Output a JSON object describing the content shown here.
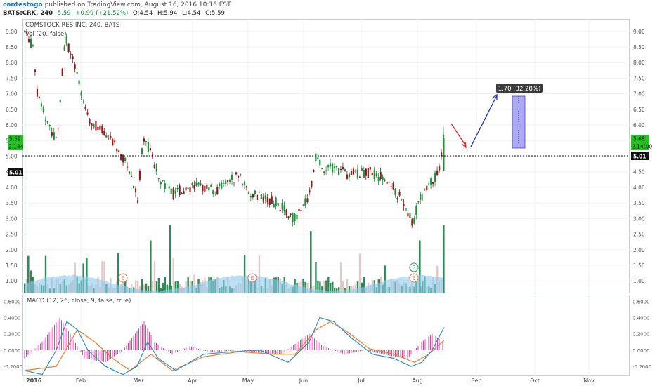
{
  "header": {
    "user": "cantestogo",
    "published_text": "published on TradingView.com, August 16, 2016 10:16 EST",
    "ticker": "BATS:CRK, 240",
    "last": "5.59",
    "change": "+0.99 (+21.52%)",
    "open": "O:4.54",
    "high": "H:5.94",
    "low": "L:4.54",
    "close": "C:5.59"
  },
  "price_pane": {
    "symbol_label": "COMSTOCK RES INC, 240, BATS",
    "volume_label": "Vol (20, false)",
    "y_ticks": [
      "9.00",
      "8.50",
      "8.00",
      "7.50",
      "7.00",
      "6.50",
      "6.00",
      "5.50",
      "5.00",
      "4.50",
      "4.00",
      "3.50",
      "3.00",
      "2.50",
      "2.00",
      "1.50",
      "1.00"
    ],
    "ylim": [
      0.6,
      9.4
    ],
    "price_badge_left": "5.59",
    "vol_badge_left": "2.144",
    "level_badge_left": "5.01",
    "price_badge_right": "5.68",
    "vol_badge_right": "2.14(00",
    "level_badge_right": "5.01",
    "horizontal_line_value": 5.0,
    "projection_label": "1.70 (32.28%)",
    "earnings_marker": "E",
    "split_marker": "S",
    "colors": {
      "up": "#1f8f3a",
      "down": "#8b1a1a",
      "vol_up": "#2e8b57",
      "vol_down": "#e0c8c8",
      "vol_ma": "#8ecbef",
      "projection": "#8c85f2",
      "arrow_red": "#e02020",
      "arrow_blue": "#1a2fc0",
      "badge_green": "#22c322",
      "badge_dark": "#111111"
    }
  },
  "macd_pane": {
    "label": "MACD (12, 26, close, 9, false, true)",
    "y_ticks": [
      "0.6000",
      "0.4000",
      "0.2000",
      "0.0000",
      "-0.2000"
    ],
    "colors": {
      "hist": "#e0409a",
      "macd": "#2b8fd4",
      "signal": "#f07b2a"
    }
  },
  "x_axis": {
    "labels": [
      "2016",
      "Feb",
      "Mar",
      "Apr",
      "May",
      "Jun",
      "Jul",
      "Aug",
      "Sep",
      "Oct",
      "Nov"
    ]
  }
}
